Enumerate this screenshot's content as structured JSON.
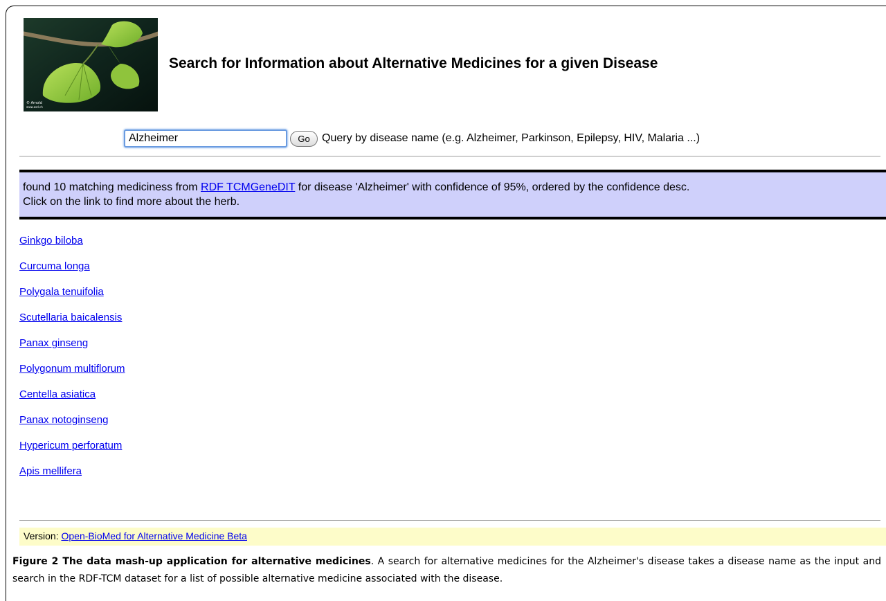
{
  "header": {
    "title": "Search for Information about Alternative Medicines for a given Disease",
    "logo_credit": "© Arnold www.asd.ch"
  },
  "search": {
    "value": "Alzheimer",
    "button_label": "Go",
    "hint": "Query by disease name (e.g. Alzheimer, Parkinson, Epilepsy, HIV, Malaria ...)"
  },
  "result": {
    "text_before_link": "found 10 matching mediciness from ",
    "link_label": "RDF TCMGeneDIT",
    "text_after_link": " for disease 'Alzheimer' with confidence of 95%, ordered by the confidence desc.",
    "line2": "Click on the link to find more about the herb."
  },
  "medicines": [
    "Ginkgo biloba",
    "Curcuma longa",
    "Polygala tenuifolia",
    "Scutellaria baicalensis",
    "Panax ginseng",
    "Polygonum multiflorum",
    "Centella asiatica",
    "Panax notoginseng",
    "Hypericum perforatum",
    "Apis mellifera"
  ],
  "footer": {
    "version_label": "Version: ",
    "version_link": "Open-BioMed for Alternative Medicine Beta"
  },
  "caption": {
    "title": "Figure 2 The data mash-up application for alternative medicines",
    "body": ". A search for alternative medicines for the Alzheimer's disease takes a disease name as the input and search in the RDF-TCM dataset for a list of possible alternative medicine associated with the disease."
  },
  "colors": {
    "link": "#0000ee",
    "result_background": "#cfd0fb",
    "version_background": "#fdfcc9",
    "input_focus": "#6a9be0"
  }
}
